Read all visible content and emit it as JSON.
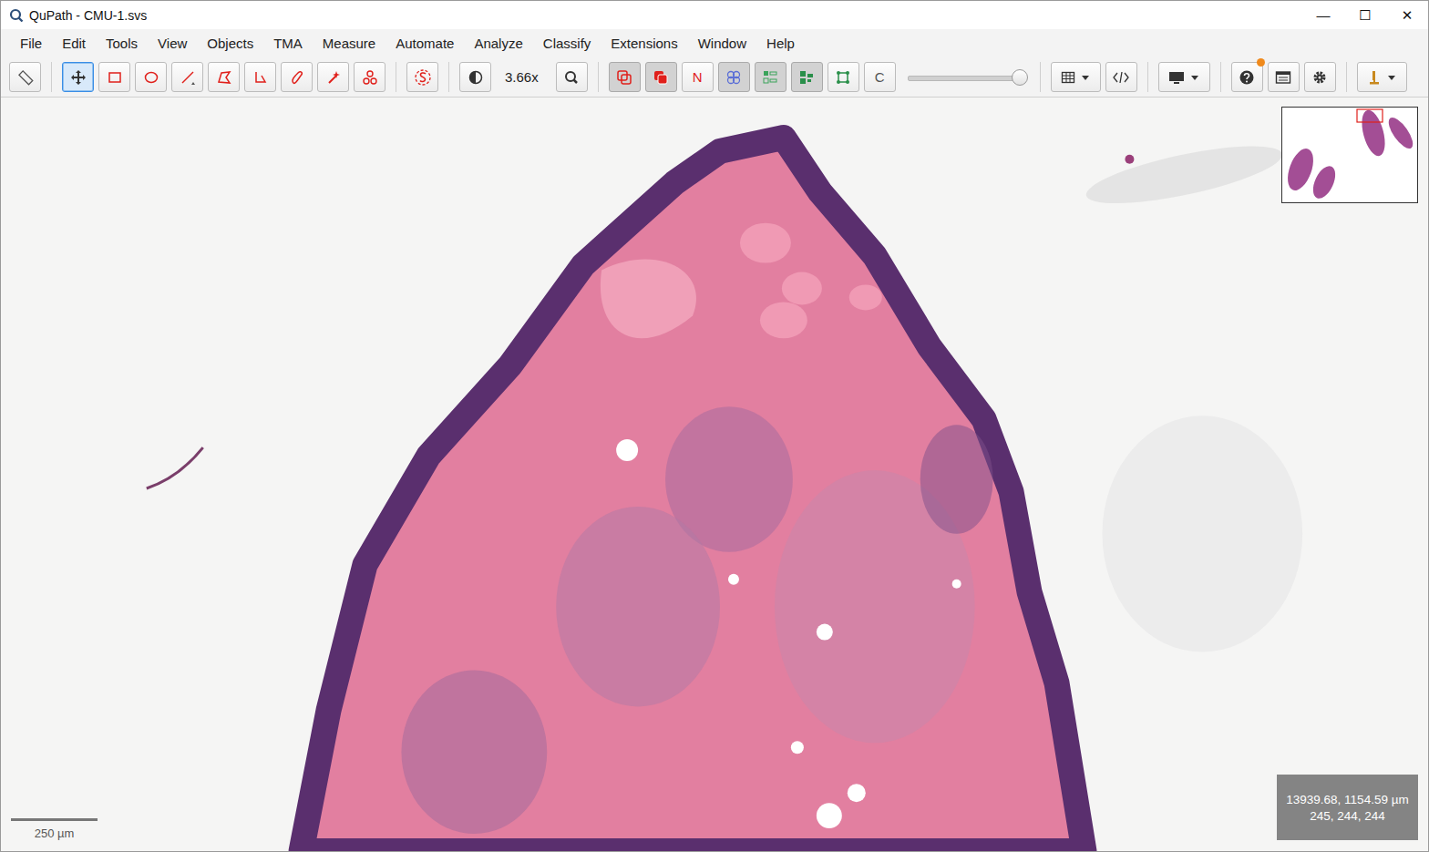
{
  "window": {
    "title": "QuPath - CMU-1.svs",
    "controls": [
      "—",
      "☐",
      "✕"
    ]
  },
  "menu": [
    "File",
    "Edit",
    "Tools",
    "View",
    "Objects",
    "TMA",
    "Measure",
    "Automate",
    "Analyze",
    "Classify",
    "Extensions",
    "Window",
    "Help"
  ],
  "toolbar": {
    "tools": {
      "measure": false,
      "move": true,
      "rectangle": false,
      "ellipse": false,
      "line": false,
      "polygon": false,
      "polyline": false,
      "brush": false,
      "wand": false,
      "points": false
    },
    "selection_mode": false,
    "zoom": "3.66x",
    "toggles": {
      "show_annotations": {
        "on": true
      },
      "fill_annotations": {
        "on": true
      },
      "names": {
        "on": false,
        "label": "N"
      },
      "show_detections": {
        "on": true
      },
      "fill_detections": {
        "on": true
      },
      "pixel_classification": {
        "on": true
      },
      "tma_grid": {
        "on": false
      },
      "cell_boundaries": {
        "on": false,
        "label": "C"
      }
    },
    "opacity": {
      "level": 0.97
    },
    "help_update_badge": true
  },
  "viewer": {
    "scale_bar": "250 µm",
    "cursor": {
      "position": "13939.68, 1154.59 µm",
      "rgb": "245, 244, 244"
    }
  }
}
